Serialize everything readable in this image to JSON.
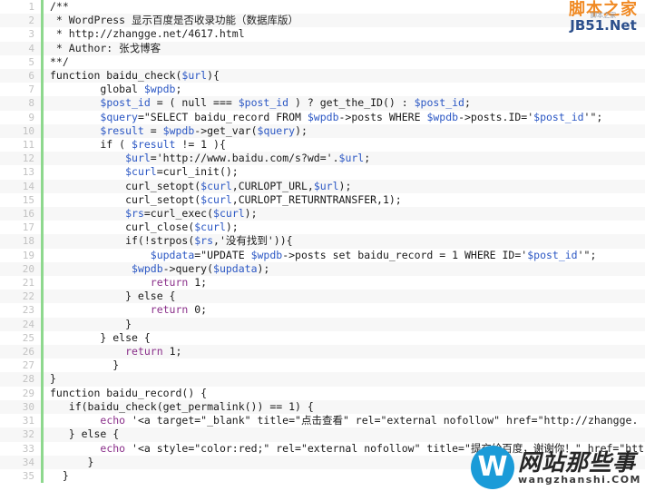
{
  "editor": {
    "language": "php",
    "gutter_accent_color": "#8ed88e",
    "line_number_color": "#c2c2c2",
    "stripe_odd_color": "#ffffff",
    "stripe_even_color": "#f7f7f7",
    "token_colors": {
      "plain": "#1a1a1a",
      "variable": "#2b57c4",
      "keyword": "#8a2f8a",
      "comment": "#1f1f1f"
    },
    "lines": [
      {
        "n": "1",
        "tokens": [
          {
            "t": "comment",
            "s": "/**"
          }
        ]
      },
      {
        "n": "2",
        "tokens": [
          {
            "t": "comment",
            "s": " * WordPress 显示百度是否收录功能（数据库版）"
          }
        ]
      },
      {
        "n": "3",
        "tokens": [
          {
            "t": "comment",
            "s": " * http://zhangge.net/4617.html"
          }
        ]
      },
      {
        "n": "4",
        "tokens": [
          {
            "t": "comment",
            "s": " * Author: 张戈博客"
          }
        ]
      },
      {
        "n": "5",
        "tokens": [
          {
            "t": "comment",
            "s": "**/"
          }
        ]
      },
      {
        "n": "6",
        "tokens": [
          {
            "t": "plain",
            "s": "function baidu_check("
          },
          {
            "t": "var",
            "s": "$url"
          },
          {
            "t": "plain",
            "s": "){"
          }
        ]
      },
      {
        "n": "7",
        "tokens": [
          {
            "t": "plain",
            "s": "        global "
          },
          {
            "t": "var",
            "s": "$wpdb"
          },
          {
            "t": "plain",
            "s": ";"
          }
        ]
      },
      {
        "n": "8",
        "tokens": [
          {
            "t": "plain",
            "s": "        "
          },
          {
            "t": "var",
            "s": "$post_id"
          },
          {
            "t": "plain",
            "s": " = ( null === "
          },
          {
            "t": "var",
            "s": "$post_id"
          },
          {
            "t": "plain",
            "s": " ) ? get_the_ID() : "
          },
          {
            "t": "var",
            "s": "$post_id"
          },
          {
            "t": "plain",
            "s": ";"
          }
        ]
      },
      {
        "n": "9",
        "tokens": [
          {
            "t": "plain",
            "s": "        "
          },
          {
            "t": "var",
            "s": "$query"
          },
          {
            "t": "plain",
            "s": "=\"SELECT baidu_record FROM "
          },
          {
            "t": "var",
            "s": "$wpdb"
          },
          {
            "t": "plain",
            "s": "->posts WHERE "
          },
          {
            "t": "var",
            "s": "$wpdb"
          },
          {
            "t": "plain",
            "s": "->posts.ID='"
          },
          {
            "t": "var",
            "s": "$post_id"
          },
          {
            "t": "plain",
            "s": "'\";"
          }
        ]
      },
      {
        "n": "10",
        "tokens": [
          {
            "t": "plain",
            "s": "        "
          },
          {
            "t": "var",
            "s": "$result"
          },
          {
            "t": "plain",
            "s": " = "
          },
          {
            "t": "var",
            "s": "$wpdb"
          },
          {
            "t": "plain",
            "s": "->get_var("
          },
          {
            "t": "var",
            "s": "$query"
          },
          {
            "t": "plain",
            "s": ");"
          }
        ]
      },
      {
        "n": "11",
        "tokens": [
          {
            "t": "plain",
            "s": "        if ( "
          },
          {
            "t": "var",
            "s": "$result"
          },
          {
            "t": "plain",
            "s": " != 1 ){"
          }
        ]
      },
      {
        "n": "12",
        "tokens": [
          {
            "t": "plain",
            "s": "            "
          },
          {
            "t": "var",
            "s": "$url"
          },
          {
            "t": "plain",
            "s": "='http://www.baidu.com/s?wd='."
          },
          {
            "t": "var",
            "s": "$url"
          },
          {
            "t": "plain",
            "s": ";"
          }
        ]
      },
      {
        "n": "13",
        "tokens": [
          {
            "t": "plain",
            "s": "            "
          },
          {
            "t": "var",
            "s": "$curl"
          },
          {
            "t": "plain",
            "s": "=curl_init();"
          }
        ]
      },
      {
        "n": "14",
        "tokens": [
          {
            "t": "plain",
            "s": "            curl_setopt("
          },
          {
            "t": "var",
            "s": "$curl"
          },
          {
            "t": "plain",
            "s": ",CURLOPT_URL,"
          },
          {
            "t": "var",
            "s": "$url"
          },
          {
            "t": "plain",
            "s": ");"
          }
        ]
      },
      {
        "n": "15",
        "tokens": [
          {
            "t": "plain",
            "s": "            curl_setopt("
          },
          {
            "t": "var",
            "s": "$curl"
          },
          {
            "t": "plain",
            "s": ",CURLOPT_RETURNTRANSFER,1);"
          }
        ]
      },
      {
        "n": "16",
        "tokens": [
          {
            "t": "plain",
            "s": "            "
          },
          {
            "t": "var",
            "s": "$rs"
          },
          {
            "t": "plain",
            "s": "=curl_exec("
          },
          {
            "t": "var",
            "s": "$curl"
          },
          {
            "t": "plain",
            "s": ");"
          }
        ]
      },
      {
        "n": "17",
        "tokens": [
          {
            "t": "plain",
            "s": "            curl_close("
          },
          {
            "t": "var",
            "s": "$curl"
          },
          {
            "t": "plain",
            "s": ");"
          }
        ]
      },
      {
        "n": "18",
        "tokens": [
          {
            "t": "plain",
            "s": "            if(!strpos("
          },
          {
            "t": "var",
            "s": "$rs"
          },
          {
            "t": "plain",
            "s": ",'没有找到')){"
          }
        ]
      },
      {
        "n": "19",
        "tokens": [
          {
            "t": "plain",
            "s": "                "
          },
          {
            "t": "var",
            "s": "$updata"
          },
          {
            "t": "plain",
            "s": "=\"UPDATE "
          },
          {
            "t": "var",
            "s": "$wpdb"
          },
          {
            "t": "plain",
            "s": "->posts set baidu_record = 1 WHERE ID='"
          },
          {
            "t": "var",
            "s": "$post_id"
          },
          {
            "t": "plain",
            "s": "'\";"
          }
        ]
      },
      {
        "n": "20",
        "tokens": [
          {
            "t": "plain",
            "s": "             "
          },
          {
            "t": "var",
            "s": "$wpdb"
          },
          {
            "t": "plain",
            "s": "->query("
          },
          {
            "t": "var",
            "s": "$updata"
          },
          {
            "t": "plain",
            "s": ");"
          }
        ]
      },
      {
        "n": "21",
        "tokens": [
          {
            "t": "plain",
            "s": "                "
          },
          {
            "t": "kw",
            "s": "return"
          },
          {
            "t": "plain",
            "s": " 1;"
          }
        ]
      },
      {
        "n": "22",
        "tokens": [
          {
            "t": "plain",
            "s": "            } else {"
          }
        ]
      },
      {
        "n": "23",
        "tokens": [
          {
            "t": "plain",
            "s": "                "
          },
          {
            "t": "kw",
            "s": "return"
          },
          {
            "t": "plain",
            "s": " 0;"
          }
        ]
      },
      {
        "n": "24",
        "tokens": [
          {
            "t": "plain",
            "s": "            }"
          }
        ]
      },
      {
        "n": "25",
        "tokens": [
          {
            "t": "plain",
            "s": "        } else {"
          }
        ]
      },
      {
        "n": "26",
        "tokens": [
          {
            "t": "plain",
            "s": "            "
          },
          {
            "t": "kw",
            "s": "return"
          },
          {
            "t": "plain",
            "s": " 1;"
          }
        ]
      },
      {
        "n": "27",
        "tokens": [
          {
            "t": "plain",
            "s": "          }"
          }
        ]
      },
      {
        "n": "28",
        "tokens": [
          {
            "t": "plain",
            "s": "}"
          }
        ]
      },
      {
        "n": "29",
        "tokens": [
          {
            "t": "plain",
            "s": "function baidu_record() {"
          }
        ]
      },
      {
        "n": "30",
        "tokens": [
          {
            "t": "plain",
            "s": "   if(baidu_check(get_permalink()) == 1) {"
          }
        ]
      },
      {
        "n": "31",
        "tokens": [
          {
            "t": "plain",
            "s": "        "
          },
          {
            "t": "kw",
            "s": "echo"
          },
          {
            "t": "plain",
            "s": " '<a target=\"_blank\" title=\"点击查看\" rel=\"external nofollow\" href=\"http://zhangge."
          }
        ]
      },
      {
        "n": "32",
        "tokens": [
          {
            "t": "plain",
            "s": "   } else {"
          }
        ]
      },
      {
        "n": "33",
        "tokens": [
          {
            "t": "plain",
            "s": "        "
          },
          {
            "t": "kw",
            "s": "echo"
          },
          {
            "t": "plain",
            "s": " '<a style=\"color:red;\" rel=\"external nofollow\" title=\"提交给百度，谢谢你！\" href=\"http://zhangge."
          }
        ]
      },
      {
        "n": "34",
        "tokens": [
          {
            "t": "plain",
            "s": "      }"
          }
        ]
      },
      {
        "n": "35",
        "tokens": [
          {
            "t": "plain",
            "s": "  }"
          }
        ]
      }
    ]
  },
  "watermarks": {
    "top_right": {
      "cn": "脚本之家",
      "en": "JB51.Net",
      "sub": "脚本之家",
      "cn_color": "#f08a24",
      "en_color": "#2c4f8c"
    },
    "bottom_right": {
      "logo_letter": "W",
      "cn": "网站那些事",
      "en": "wangzhanshi.COM",
      "logo_color": "#1b9bd8"
    }
  }
}
